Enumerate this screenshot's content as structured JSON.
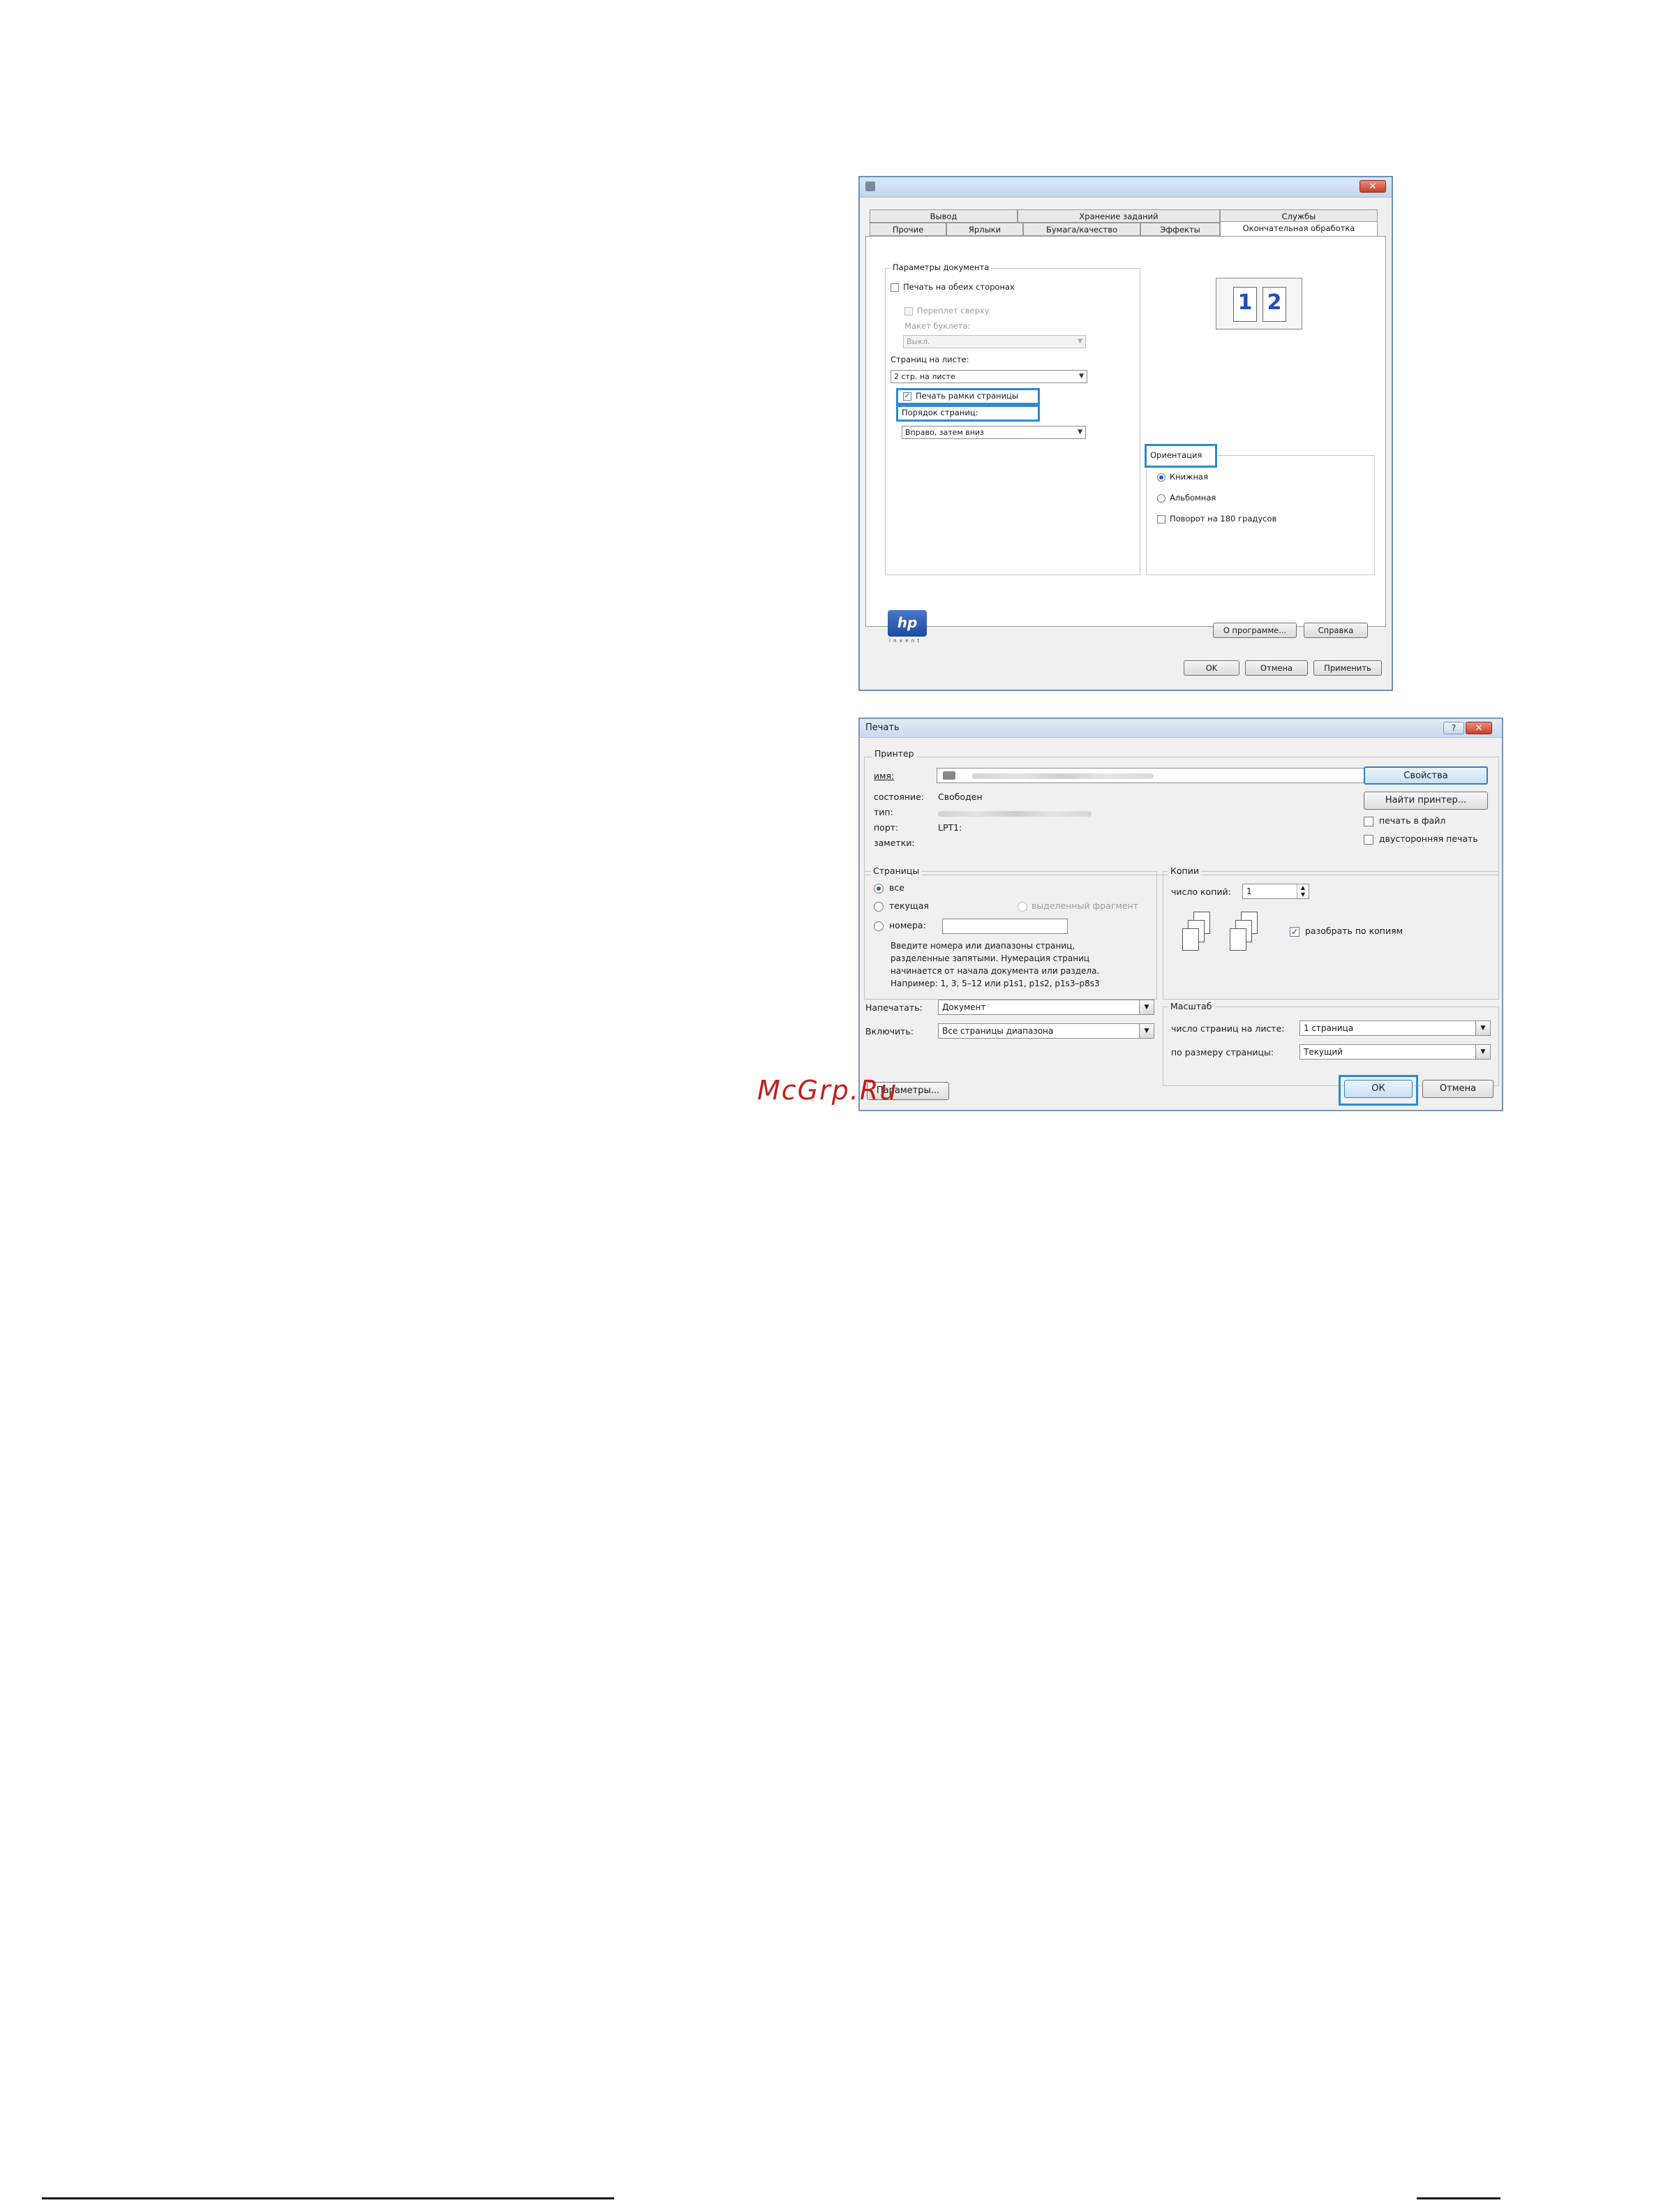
{
  "watermark": "McGrp.Ru",
  "hp_dialog": {
    "tabs_row1": [
      "Вывод",
      "Хранение заданий",
      "Службы"
    ],
    "tabs_row2": [
      "Прочие",
      "Ярлыки",
      "Бумага/качество",
      "Эффекты",
      "Окончательная обработка"
    ],
    "doc_params": {
      "group_label": "Параметры документа",
      "duplex_label": "Печать на обеих сторонах",
      "flip_up_label": "Переплет сверху",
      "booklet_label": "Макет буклета:",
      "booklet_value": "Выкл.",
      "pages_per_sheet_label": "Страниц на листе:",
      "pages_per_sheet_value": "2 стр. на листе",
      "print_borders_label": "Печать рамки страницы",
      "page_order_label": "Порядок страниц:",
      "page_order_value": "Вправо, затем вниз"
    },
    "preview_pages": [
      "1",
      "2"
    ],
    "orientation": {
      "group_label": "Ориентация",
      "portrait_label": "Книжная",
      "landscape_label": "Альбомная",
      "rotate_label": "Поворот на 180 градусов"
    },
    "logo_text": "hp",
    "logo_sub": "i n v e n t",
    "about_label": "О программе...",
    "help_label": "Справка",
    "ok_label": "OK",
    "cancel_label": "Отмена",
    "apply_label": "Применить"
  },
  "print_dialog": {
    "title": "Печать",
    "help_glyph": "?",
    "close_glyph": "✕",
    "printer": {
      "group_label": "Принтер",
      "name_label": "имя:",
      "status_label": "состояние:",
      "status_value": "Свободен",
      "type_label": "тип:",
      "port_label": "порт:",
      "port_value": "LPT1:",
      "notes_label": "заметки:",
      "properties_label": "Свойства",
      "find_printer_label": "Найти принтер...",
      "print_to_file_label": "печать в файл",
      "duplex_label": "двусторонняя печать"
    },
    "pages": {
      "group_label": "Страницы",
      "all_label": "все",
      "current_label": "текущая",
      "selection_label": "выделенный фрагмент",
      "numbers_label": "номера:",
      "hint": [
        "Введите номера или диапазоны страниц,",
        "разделенные запятыми. Нумерация страниц",
        "начинается от начала документа или раздела.",
        "Например: 1, 3, 5–12 или p1s1, p1s2, p1s3–p8s3"
      ]
    },
    "copies": {
      "group_label": "Копии",
      "count_label": "число копий:",
      "count_value": "1",
      "collate_label": "разобрать по копиям"
    },
    "print_what_label": "Напечатать:",
    "print_what_value": "Документ",
    "include_label": "Включить:",
    "include_value": "Все страницы диапазона",
    "scale": {
      "group_label": "Масштаб",
      "pages_per_sheet_label": "число страниц на листе:",
      "pages_per_sheet_value": "1 страница",
      "scale_to_paper_label": "по размеру страницы:",
      "scale_to_paper_value": "Текущий"
    },
    "options_label": "Параметры...",
    "ok_label": "ОК",
    "cancel_label": "Отмена"
  }
}
